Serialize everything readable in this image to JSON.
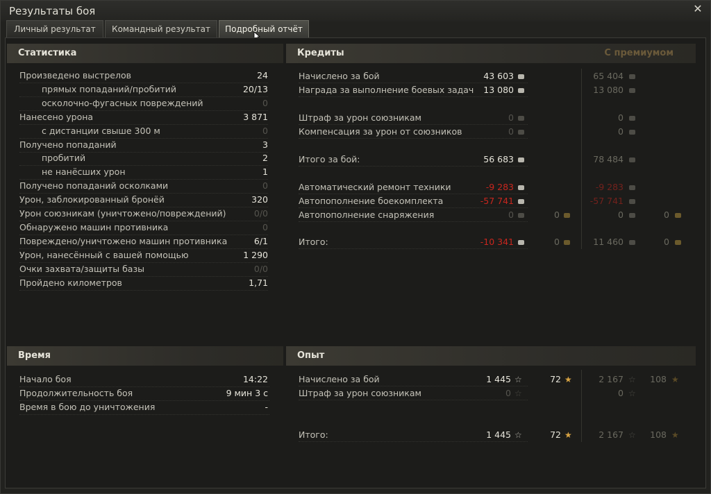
{
  "window": {
    "title": "Результаты боя"
  },
  "tabs": [
    {
      "label": "Личный результат"
    },
    {
      "label": "Командный результат"
    },
    {
      "label": "Подробный отчёт"
    }
  ],
  "statistics": {
    "title": "Статистика",
    "rows": [
      {
        "label": "Произведено выстрелов",
        "value": "24"
      },
      {
        "label": "прямых попаданий/пробитий",
        "value": "20/13"
      },
      {
        "label": "осколочно-фугасных повреждений",
        "value": "0"
      },
      {
        "label": "Нанесено урона",
        "value": "3 871"
      },
      {
        "label": "с дистанции свыше 300 м",
        "value": "0"
      },
      {
        "label": "Получено попаданий",
        "value": "3"
      },
      {
        "label": "пробитий",
        "value": "2"
      },
      {
        "label": "не нанёсших урон",
        "value": "1"
      },
      {
        "label": "Получено попаданий осколками",
        "value": "0"
      },
      {
        "label": "Урон, заблокированный бронёй",
        "value": "320"
      },
      {
        "label": "Урон союзникам (уничтожено/повреждений)",
        "value": "0/0"
      },
      {
        "label": "Обнаружено машин противника",
        "value": "0"
      },
      {
        "label": "Повреждено/уничтожено машин противника",
        "value": "6/1"
      },
      {
        "label": "Урон, нанесённый с вашей помощью",
        "value": "1 290"
      },
      {
        "label": "Очки захвата/защиты базы",
        "value": "0/0"
      },
      {
        "label": "Пройдено километров",
        "value": "1,71"
      }
    ]
  },
  "credits": {
    "title": "Кредиты",
    "premium_label": "С премиумом",
    "rows": [
      {
        "label": "Начислено за бой",
        "value": "43 603",
        "prem": "65 404"
      },
      {
        "label": "Награда за выполнение боевых задач",
        "value": "13 080",
        "prem": "13 080"
      },
      {
        "label": "Штраф за урон союзникам",
        "value": "0",
        "prem": "0"
      },
      {
        "label": "Компенсация за урон от союзников",
        "value": "0",
        "prem": "0"
      },
      {
        "label": "Итого за бой:",
        "value": "56 683",
        "prem": "78 484"
      },
      {
        "label": "Автоматический ремонт техники",
        "value": "-9 283",
        "prem": "-9 283"
      },
      {
        "label": "Автопополнение боекомплекта",
        "value": "-57 741",
        "prem": "-57 741"
      },
      {
        "label": "Автопополнение снаряжения",
        "value": "0",
        "gold": "0",
        "prem": "0",
        "prem_gold": "0"
      },
      {
        "label": "Итого:",
        "value": "-10 341",
        "gold": "0",
        "prem": "11 460",
        "prem_gold": "0"
      }
    ]
  },
  "time": {
    "title": "Время",
    "rows": [
      {
        "label": "Начало боя",
        "value": "14:22"
      },
      {
        "label": "Продолжительность боя",
        "value": "9 мин 3 с"
      },
      {
        "label": "Время в бою до уничтожения",
        "value": "-"
      }
    ]
  },
  "experience": {
    "title": "Опыт",
    "rows": [
      {
        "label": "Начислено за бой",
        "value": "1 445",
        "free": "72",
        "prem": "2 167",
        "prem_free": "108"
      },
      {
        "label": "Штраф за урон союзникам",
        "value": "0",
        "prem": "0"
      },
      {
        "label": "Итого:",
        "value": "1 445",
        "free": "72",
        "prem": "2 167",
        "prem_free": "108"
      }
    ]
  },
  "colors": {
    "accent": "#d9a443",
    "negative": "#c9261e",
    "premium_header": "#6b5a3a"
  }
}
